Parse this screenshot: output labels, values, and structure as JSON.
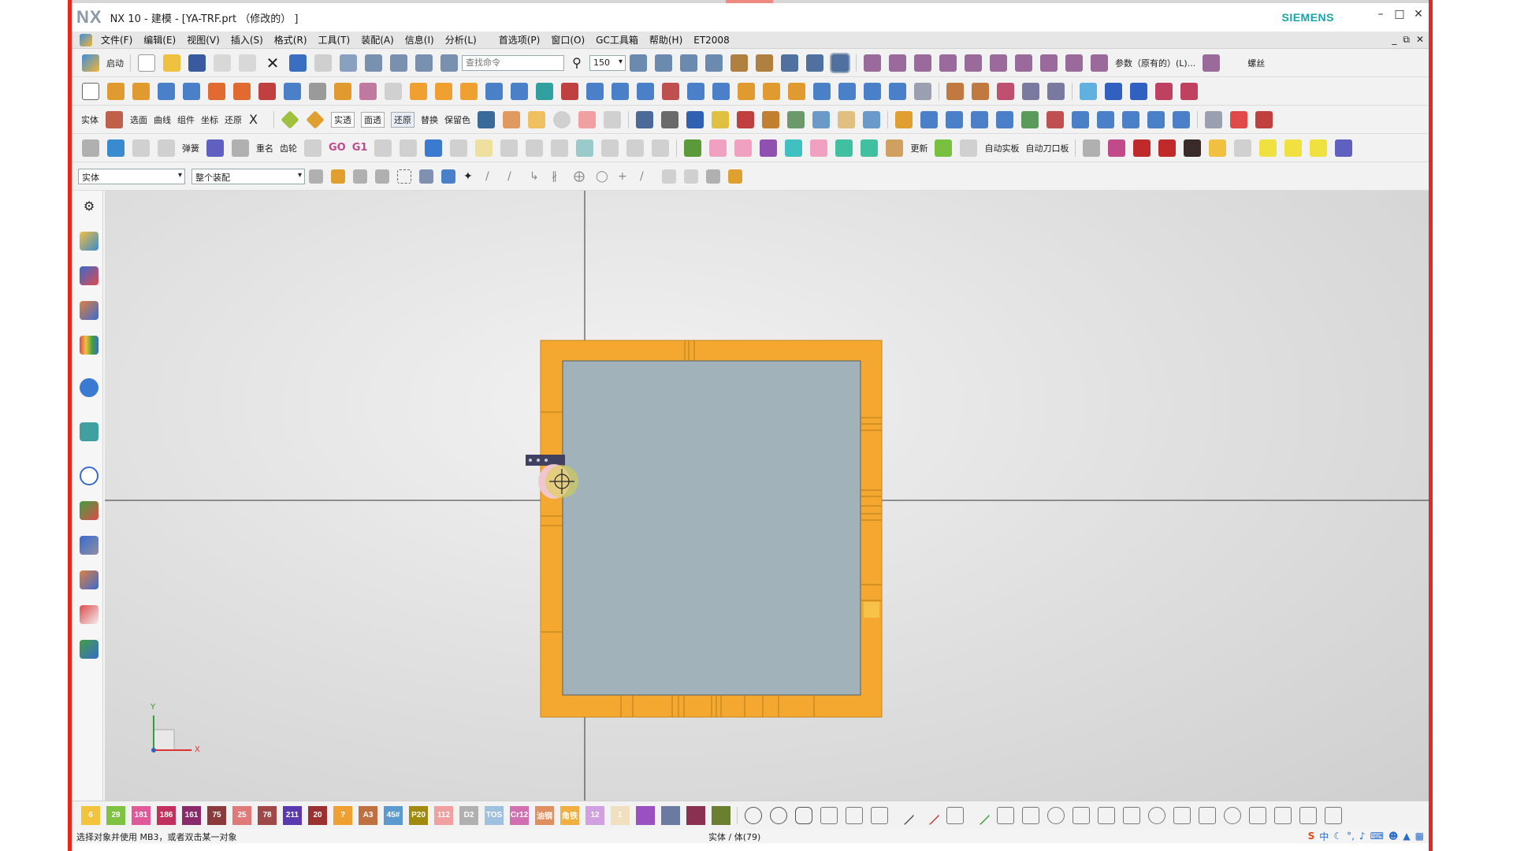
{
  "window": {
    "logo": "NX",
    "title": "NX 10 - 建模 - [YA-TRF.prt （修改的） ]",
    "brand": "SIEMENS",
    "controls": [
      "minimize-icon",
      "maximize-icon",
      "close-icon"
    ]
  },
  "menu": {
    "items": [
      "文件(F)",
      "编辑(E)",
      "视图(V)",
      "插入(S)",
      "格式(R)",
      "工具(T)",
      "装配(A)",
      "信息(I)",
      "分析(L)",
      "首选项(P)",
      "窗口(O)",
      "GC工具箱",
      "帮助(H)",
      "ET2008"
    ]
  },
  "toolbar1": {
    "start_label": "启动",
    "search_placeholder": "查找命令",
    "zoom_value": "150",
    "param_label": "参数（原有的）(L)...",
    "right_label": "螺丝"
  },
  "toolbar3": {
    "labels": [
      "实体",
      "选面",
      "曲线",
      "组件",
      "坐标",
      "还原"
    ],
    "mid_labels": [
      "实透",
      "面透",
      "还原",
      "替换",
      "保留色"
    ]
  },
  "toolbar4": {
    "labels": [
      "弹簧",
      "重名",
      "齿轮",
      "GO",
      "G1",
      "更新",
      "自动实板",
      "自动刀口板"
    ]
  },
  "selection": {
    "type_filter": "实体",
    "scope": "整个装配"
  },
  "quick_boxes": [
    {
      "label": "6",
      "color": "#f3c33c"
    },
    {
      "label": "29",
      "color": "#7fc241"
    },
    {
      "label": "181",
      "color": "#e05a9a"
    },
    {
      "label": "186",
      "color": "#c2305f"
    },
    {
      "label": "161",
      "color": "#8a2a6a"
    },
    {
      "label": "75",
      "color": "#8a3a3a"
    },
    {
      "label": "25",
      "color": "#e07a7a"
    },
    {
      "label": "78",
      "color": "#a04848"
    },
    {
      "label": "211",
      "color": "#5a38b0"
    },
    {
      "label": "20",
      "color": "#9a3030"
    },
    {
      "label": "?",
      "color": "#f0a030"
    },
    {
      "label": "A3",
      "color": "#c07040"
    },
    {
      "label": "45#",
      "color": "#5a9ad0"
    },
    {
      "label": "P20",
      "color": "#a08a10"
    },
    {
      "label": "112",
      "color": "#f0a0a0"
    },
    {
      "label": "D2",
      "color": "#b0b0b0"
    },
    {
      "label": "TOS",
      "color": "#a0c0e0"
    },
    {
      "label": "Cr12",
      "color": "#d070b0"
    },
    {
      "label": "油钢",
      "color": "#e09060"
    },
    {
      "label": "角铁",
      "color": "#f0b040"
    },
    {
      "label": "12",
      "color": "#d0a0e0"
    },
    {
      "label": "1",
      "color": "#f0e0c0"
    },
    {
      "label": "",
      "color": "#9a50c0"
    },
    {
      "label": "",
      "color": "#6a7aa0"
    },
    {
      "label": "",
      "color": "#8a3050"
    },
    {
      "label": "",
      "color": "#6a8030"
    }
  ],
  "status": {
    "prompt": "选择对象并使用 MB3，或者双击某一对象",
    "selection": "实体 / 体(79)"
  },
  "triad": {
    "x_label": "X",
    "y_label": "Y"
  },
  "colors": {
    "accent_orange": "#f4a830",
    "plate_blue_gray": "#a2b2bb",
    "frame_red": "#e8281e",
    "brand_teal": "#1aa4a8"
  }
}
